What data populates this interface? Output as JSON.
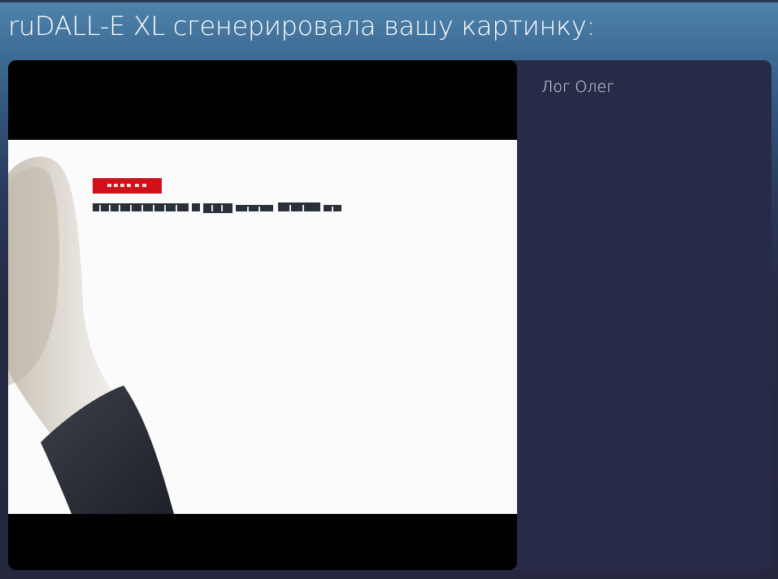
{
  "header": {
    "title": "ruDALL-E XL сгенерировала вашу картинку:"
  },
  "result": {
    "image_alt": "generated image: hand near a white presentation slide",
    "prompt": "Лог Олег"
  },
  "colors": {
    "card_background": "#282b48",
    "slide_tag_red": "#d0111a",
    "title_text": "#ffffff"
  }
}
